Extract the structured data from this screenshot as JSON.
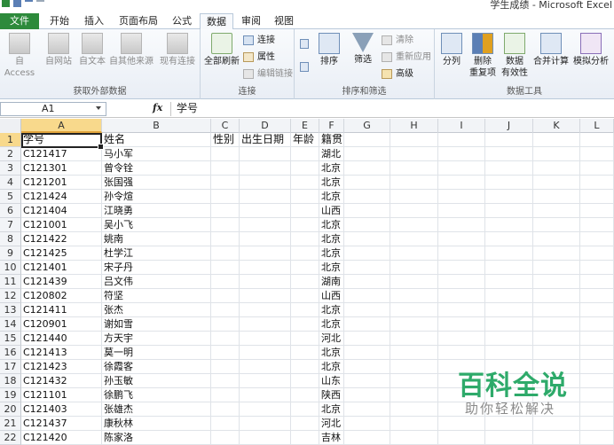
{
  "window": {
    "title": "学生成绩 - Microsoft Excel"
  },
  "tabs": [
    {
      "label": "文件"
    },
    {
      "label": "开始"
    },
    {
      "label": "插入"
    },
    {
      "label": "页面布局"
    },
    {
      "label": "公式"
    },
    {
      "label": "数据"
    },
    {
      "label": "审阅"
    },
    {
      "label": "视图"
    }
  ],
  "ribbon": {
    "external": {
      "label": "获取外部数据",
      "access": "自 Access",
      "web": "自网站",
      "text": "自文本",
      "other": "自其他来源",
      "existing": "现有连接"
    },
    "connections": {
      "label": "连接",
      "refresh_all": "全部刷新",
      "connections": "连接",
      "properties": "属性",
      "edit_links": "编辑链接"
    },
    "sort_filter": {
      "label": "排序和筛选",
      "sort": "排序",
      "filter": "筛选",
      "clear": "清除",
      "reapply": "重新应用",
      "advanced": "高级"
    },
    "tools": {
      "label": "数据工具",
      "split": "分列",
      "remove_dup_line1": "删除",
      "remove_dup_line2": "重复项",
      "validation_line1": "数据",
      "validation_line2": "有效性",
      "consolidate": "合并计算",
      "whatif": "模拟分析"
    }
  },
  "formula_bar": {
    "name_box": "A1",
    "fx": "fx",
    "value": "学号"
  },
  "columns": [
    "A",
    "B",
    "C",
    "D",
    "E",
    "F",
    "G",
    "H",
    "I",
    "J",
    "K",
    "L"
  ],
  "header_row": {
    "A": "学号",
    "B": "姓名",
    "C": "性别",
    "D": "出生日期",
    "E": "年龄",
    "F": "籍贯"
  },
  "rows": [
    {
      "num": "2",
      "id": "C121417",
      "name": "马小军",
      "place": "湖北"
    },
    {
      "num": "3",
      "id": "C121301",
      "name": "曾令铨",
      "place": "北京"
    },
    {
      "num": "4",
      "id": "C121201",
      "name": "张国强",
      "place": "北京"
    },
    {
      "num": "5",
      "id": "C121424",
      "name": "孙令煊",
      "place": "北京"
    },
    {
      "num": "6",
      "id": "C121404",
      "name": "江晓勇",
      "place": "山西"
    },
    {
      "num": "7",
      "id": "C121001",
      "name": "吴小飞",
      "place": "北京"
    },
    {
      "num": "8",
      "id": "C121422",
      "name": "姚南",
      "place": "北京"
    },
    {
      "num": "9",
      "id": "C121425",
      "name": "杜学江",
      "place": "北京"
    },
    {
      "num": "10",
      "id": "C121401",
      "name": "宋子丹",
      "place": "北京"
    },
    {
      "num": "11",
      "id": "C121439",
      "name": "吕文伟",
      "place": "湖南"
    },
    {
      "num": "12",
      "id": "C120802",
      "name": "符坚",
      "place": "山西"
    },
    {
      "num": "13",
      "id": "C121411",
      "name": "张杰",
      "place": "北京"
    },
    {
      "num": "14",
      "id": "C120901",
      "name": "谢如雪",
      "place": "北京"
    },
    {
      "num": "15",
      "id": "C121440",
      "name": "方天宇",
      "place": "河北"
    },
    {
      "num": "16",
      "id": "C121413",
      "name": "莫一明",
      "place": "北京"
    },
    {
      "num": "17",
      "id": "C121423",
      "name": "徐霞客",
      "place": "北京"
    },
    {
      "num": "18",
      "id": "C121432",
      "name": "孙玉敏",
      "place": "山东"
    },
    {
      "num": "19",
      "id": "C121101",
      "name": "徐鹏飞",
      "place": "陕西"
    },
    {
      "num": "20",
      "id": "C121403",
      "name": "张雄杰",
      "place": "北京"
    },
    {
      "num": "21",
      "id": "C121437",
      "name": "康秋林",
      "place": "河北"
    },
    {
      "num": "22",
      "id": "C121420",
      "name": "陈家洛",
      "place": "吉林"
    }
  ],
  "watermark": {
    "title": "百科全说",
    "subtitle": "助你轻松解决"
  },
  "colors": {
    "file_tab": "#2d8a3b",
    "selected_header": "#f8d98c",
    "watermark_green": "#2eaa6a"
  }
}
